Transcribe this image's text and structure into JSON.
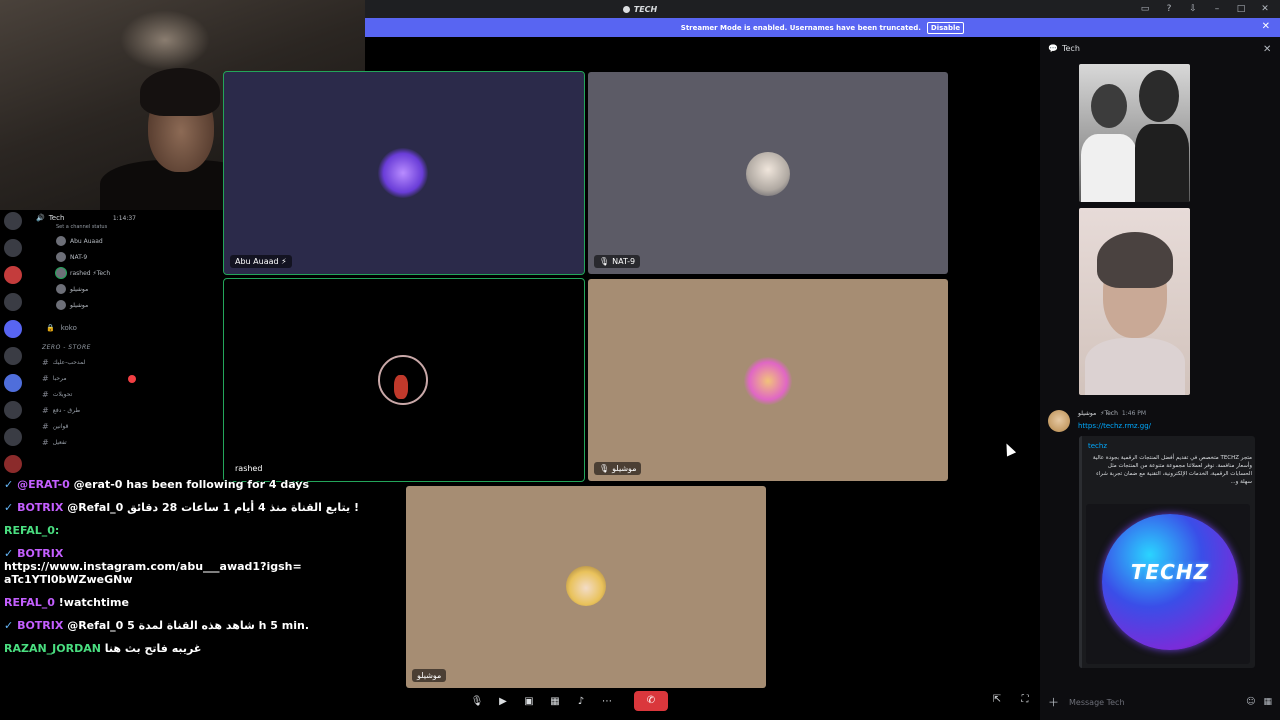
{
  "window": {
    "title": "TECH"
  },
  "banner": {
    "text": "Streamer Mode is enabled. Usernames have been truncated.",
    "button": "Disable"
  },
  "sidebar": {
    "voice_channel": {
      "name": "Tech",
      "elapsed": "1:14:37",
      "status": "Set a channel status"
    },
    "voice_users": [
      {
        "name": "Abu Auaad"
      },
      {
        "name": "NAT-9"
      },
      {
        "name": "rashed ⚡Tech"
      },
      {
        "name": "موشيلو"
      },
      {
        "name": "موشيلو"
      }
    ],
    "other_channel": "koko",
    "category": "ZERO - STORE",
    "channels": [
      {
        "name": "لمدحب-عليك"
      },
      {
        "name": "مرحبا"
      },
      {
        "name": "تحويلات"
      },
      {
        "name": "طرق - دفع"
      },
      {
        "name": "قوانين"
      },
      {
        "name": "تفعيل"
      }
    ]
  },
  "chat": [
    {
      "user": "@ERAT-0",
      "text": "@erat-0 has been following for 4 days"
    },
    {
      "user": "BOTRIX",
      "text": "@Refal_0 يتابع القناة منذ 4 أيام 1 ساعات 28 دقائق !"
    },
    {
      "user": "REFAL_0:",
      "text": ""
    },
    {
      "user": "BOTRIX",
      "text": "https://www.instagram.com/abu___awad1?igsh=aTc1YTl0bWZweGNw"
    },
    {
      "user": "REFAL_0",
      "text": "!watchtime"
    },
    {
      "user": "BOTRIX",
      "text": "@Refal_0 شاهد هذه القناة لمدة 5 h 5 min."
    },
    {
      "user": "RAZAN_JORDAN",
      "text": "غريبه فاتح بث هنا"
    }
  ],
  "tiles": [
    {
      "label": "Abu Auaad ⚡"
    },
    {
      "label": "NAT-9"
    },
    {
      "label": "rashed"
    },
    {
      "label": "موشيلو"
    },
    {
      "label": "موشيلو"
    }
  ],
  "panel": {
    "header": "Tech",
    "message": {
      "author": "موشيلو",
      "tag": "⚡Tech",
      "time": "1:46 PM",
      "link": "https://techz.rmz.gg/",
      "embed_title": "techz",
      "embed_desc": "متجر TECHZ متخصص في تقديم أفضل المنتجات الرقمية بجودة عالية وأسعار منافسة. نوفر لعملائنا مجموعة متنوعة من المنتجات مثل الحسابات الرقمية، الخدمات الإلكترونية، التقنية مع ضمان تجربة شراء سهلة و...",
      "embed_logo": "TECHZ"
    },
    "input_placeholder": "Message Tech"
  }
}
